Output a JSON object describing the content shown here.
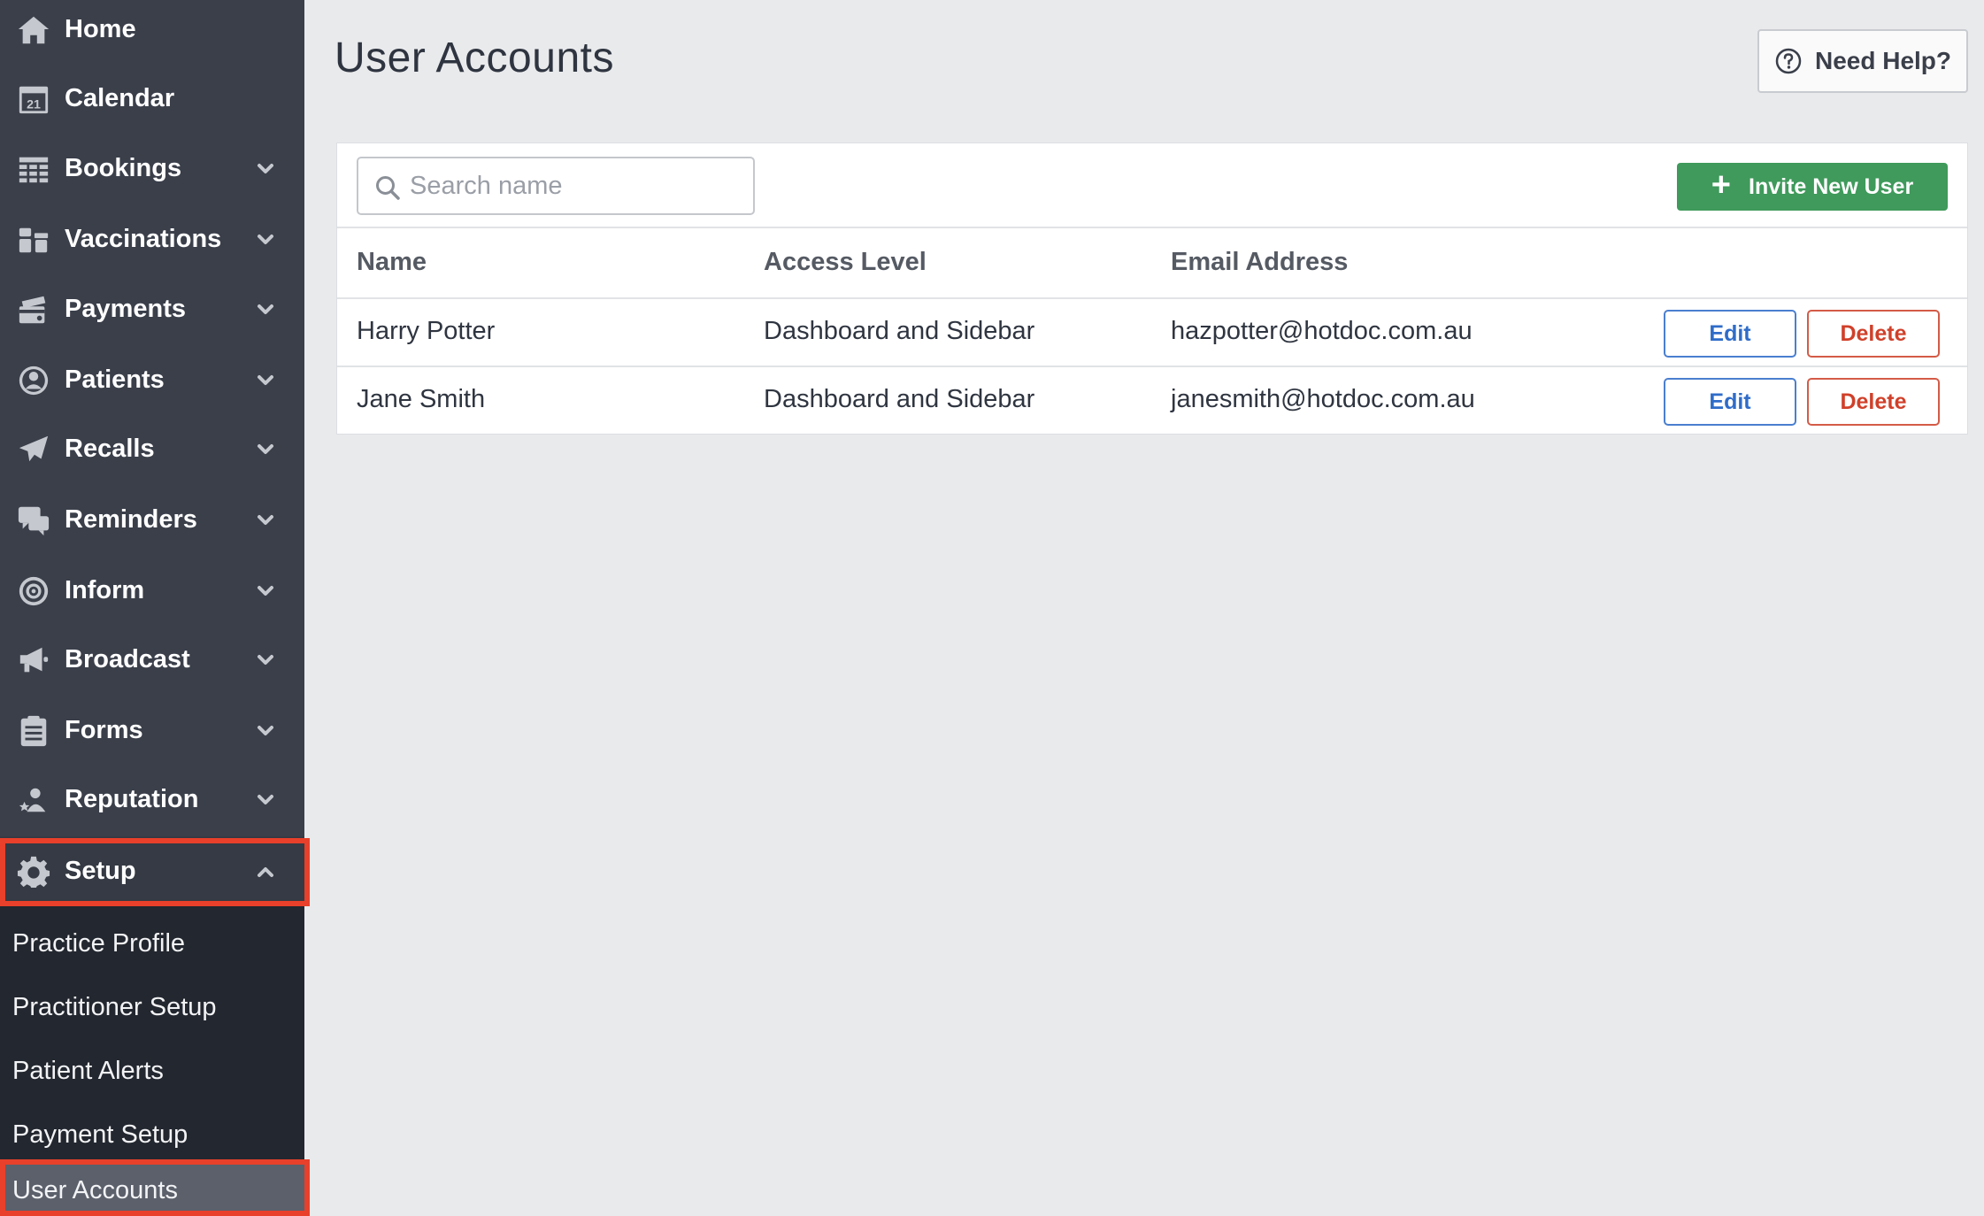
{
  "sidebar": {
    "items": [
      {
        "label": "Home",
        "icon": "home-icon"
      },
      {
        "label": "Calendar",
        "icon": "calendar-icon",
        "icon_text": "21"
      },
      {
        "label": "Bookings",
        "icon": "grid-icon"
      },
      {
        "label": "Vaccinations",
        "icon": "vials-icon"
      },
      {
        "label": "Payments",
        "icon": "card-icon"
      },
      {
        "label": "Patients",
        "icon": "user-circle-icon"
      },
      {
        "label": "Recalls",
        "icon": "paper-plane-icon"
      },
      {
        "label": "Reminders",
        "icon": "chat-icon"
      },
      {
        "label": "Inform",
        "icon": "target-icon"
      },
      {
        "label": "Broadcast",
        "icon": "megaphone-icon"
      },
      {
        "label": "Forms",
        "icon": "clipboard-icon"
      },
      {
        "label": "Reputation",
        "icon": "user-star-icon"
      },
      {
        "label": "Setup",
        "icon": "gear-icon"
      }
    ],
    "setup_submenu": [
      {
        "label": "Practice Profile"
      },
      {
        "label": "Practitioner Setup"
      },
      {
        "label": "Patient Alerts"
      },
      {
        "label": "Payment Setup"
      },
      {
        "label": "User Accounts"
      }
    ],
    "colors": {
      "background": "#3a3f4a",
      "submenu": "#23272f",
      "highlight": "#e8402a"
    }
  },
  "header": {
    "title": "User Accounts",
    "help_label": "Need Help?"
  },
  "toolbar": {
    "search_placeholder": "Search name",
    "invite_label": "Invite New User",
    "invite_color": "#3f9a5b"
  },
  "table": {
    "columns": [
      "Name",
      "Access Level",
      "Email Address"
    ],
    "rows": [
      {
        "name": "Harry Potter",
        "access": "Dashboard and Sidebar",
        "email": "hazpotter@hotdoc.com.au"
      },
      {
        "name": "Jane Smith",
        "access": "Dashboard and Sidebar",
        "email": "janesmith@hotdoc.com.au"
      }
    ],
    "edit_label": "Edit",
    "delete_label": "Delete"
  }
}
